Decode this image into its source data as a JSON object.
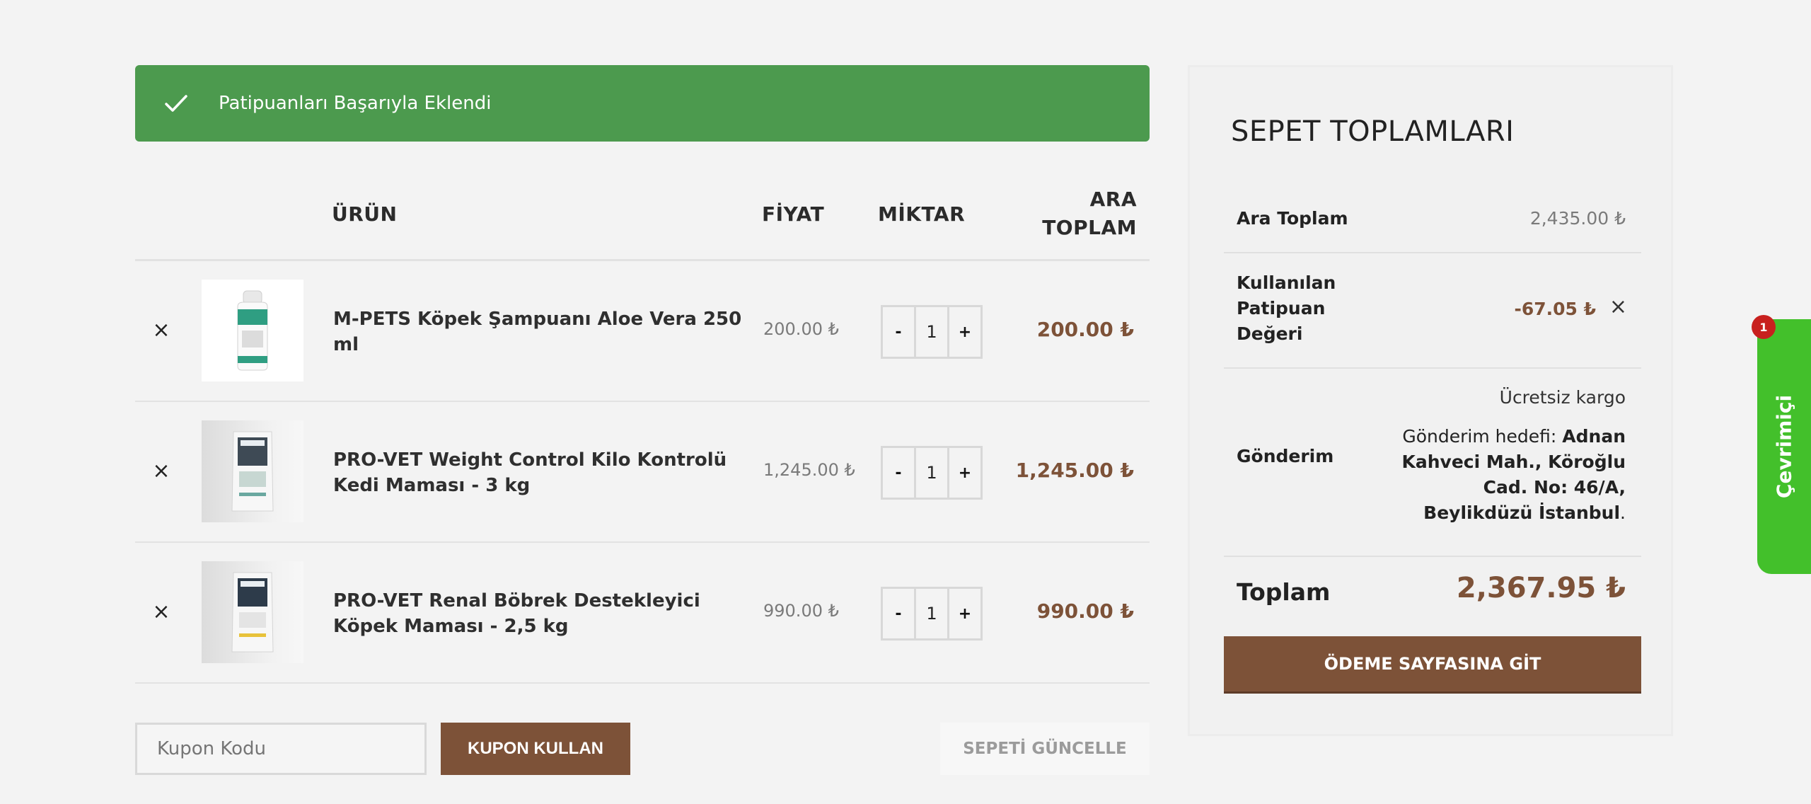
{
  "notice": {
    "message": "Patipuanları Başarıyla Eklendi"
  },
  "cart": {
    "headers": {
      "product": "ÜRÜN",
      "price": "FİYAT",
      "quantity": "MİKTAR",
      "subtotal": "ARA TOPLAM"
    },
    "items": [
      {
        "name": "M-PETS Köpek Şampuanı Aloe Vera 250 ml",
        "price": "200.00 ₺",
        "qty": "1",
        "subtotal": "200.00 ₺"
      },
      {
        "name": "PRO-VET Weight Control Kilo Kontrolü Kedi Maması - 3 kg",
        "price": "1,245.00 ₺",
        "qty": "1",
        "subtotal": "1,245.00 ₺"
      },
      {
        "name": "PRO-VET Renal Böbrek Destekleyici Köpek Maması - 2,5 kg",
        "price": "990.00 ₺",
        "qty": "1",
        "subtotal": "990.00 ₺"
      }
    ],
    "remove_symbol": "×",
    "minus": "-",
    "plus": "+",
    "coupon_placeholder": "Kupon Kodu",
    "coupon_button": "KUPON KULLAN",
    "update_button": "SEPETİ GÜNCELLE"
  },
  "totals": {
    "title": "SEPET TOPLAMLARI",
    "subtotal_label": "Ara Toplam",
    "subtotal_value": "2,435.00 ₺",
    "points_label": "Kullanılan Patipuan Değeri",
    "points_value": "-67.05 ₺",
    "points_remove": "×",
    "shipping_label": "Gönderim",
    "shipping_free": "Ücretsiz kargo",
    "shipping_prefix": "Gönderim hedefi: ",
    "shipping_address": "Adnan Kahveci Mah., Köroğlu Cad. No: 46/A, Beylikdüzü İstanbul",
    "shipping_suffix": ".",
    "total_label": "Toplam",
    "total_value": "2,367.95 ₺",
    "checkout_button": "ÖDEME SAYFASINA GİT"
  },
  "chat": {
    "label": "Çevrimiçi",
    "badge": "1"
  },
  "colors": {
    "success": "#4c9a4e",
    "brand": "#7d5238",
    "chat": "#43c02b",
    "badge": "#c8201e"
  },
  "icons": {
    "notice": "check-icon",
    "remove": "close-icon"
  }
}
